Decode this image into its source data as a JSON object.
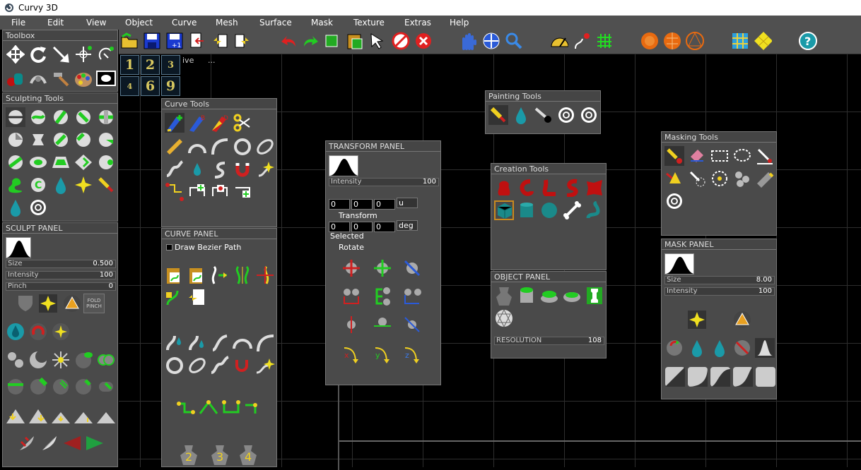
{
  "app": {
    "title": "Curvy 3D"
  },
  "menu": [
    "File",
    "Edit",
    "View",
    "Object",
    "Curve",
    "Mesh",
    "Surface",
    "Mask",
    "Texture",
    "Extras",
    "Help"
  ],
  "viewport": {
    "buttons": [
      "1",
      "2",
      "3",
      "4",
      "6",
      "9"
    ],
    "label_fragment": "ive",
    "label_dots": "..."
  },
  "toolbox": {
    "title": "Toolbox"
  },
  "sculpting": {
    "title": "Sculpting Tools"
  },
  "sculpt_panel": {
    "title": "SCULPT   PANEL",
    "size_label": "Size",
    "size_value": "0.500",
    "intensity_label": "Intensity",
    "intensity_value": "100",
    "pinch_label": "Pinch",
    "pinch_value": "0",
    "fold_label": "FOLD PINCH"
  },
  "curve_tools": {
    "title": "Curve Tools"
  },
  "curve_panel": {
    "title": "CURVE   PANEL",
    "checkbox_label": "Draw Bezier Path",
    "steps": [
      "2",
      "3",
      "4"
    ]
  },
  "transform_panel": {
    "title": "TRANSFORM   PANEL",
    "intensity_label": "Intensity",
    "intensity_value": "100",
    "t_x": "0",
    "t_y": "0",
    "t_z": "0",
    "t_unit": "u",
    "transform_label": "Transform",
    "r_x": "0",
    "r_y": "0",
    "r_z": "0",
    "r_unit": "deg",
    "selected_label": "Selected",
    "rotate_label": "Rotate",
    "axes": [
      "x",
      "y",
      "z"
    ]
  },
  "painting_tools": {
    "title": "Painting Tools"
  },
  "creation_tools": {
    "title": "Creation Tools"
  },
  "object_panel": {
    "title": "OBJECT   PANEL",
    "resolution_label": "RESOLUTION",
    "resolution_value": "108"
  },
  "masking_tools": {
    "title": "Masking Tools"
  },
  "mask_panel": {
    "title": "MASK   PANEL",
    "size_label": "Size",
    "size_value": "8.00",
    "intensity_label": "Intensity",
    "intensity_value": "100"
  },
  "colors": {
    "accent_green": "#22cc22",
    "accent_red": "#d02020",
    "accent_teal": "#1a9aa8",
    "accent_yellow": "#f0d020",
    "panel_bg": "#4a4a4a",
    "menubar_bg": "#505050"
  },
  "icons": {
    "toolbar": [
      "open-folder-icon",
      "save-icon",
      "save-as-icon",
      "import-icon",
      "export-in-icon",
      "export-out-icon",
      "undo-icon",
      "redo-icon",
      "cube-icon",
      "paste-cube-icon",
      "select-arrow-icon",
      "no-symmetry-icon",
      "cancel-icon",
      "hand-pan-icon",
      "orbit-icon",
      "zoom-icon",
      "protractor-icon",
      "pen-curve-icon",
      "grid-icon",
      "sphere-orange-icon",
      "sphere-wire-icon",
      "sphere-mesh-icon",
      "frame-grid-icon",
      "diamond-grid-icon",
      "help-icon"
    ]
  }
}
